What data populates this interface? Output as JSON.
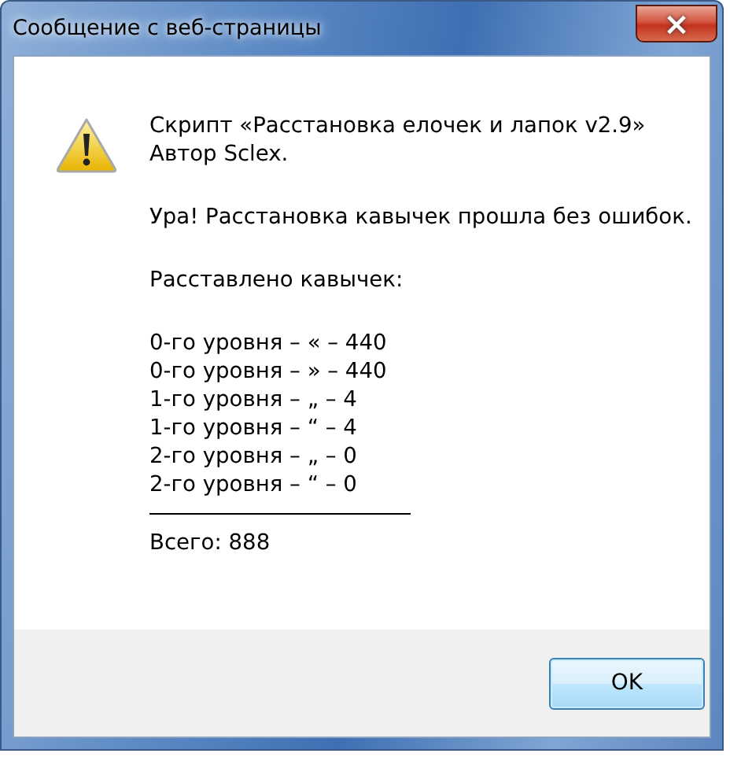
{
  "window": {
    "title": "Сообщение с веб-страницы",
    "close_button": "×"
  },
  "message": {
    "paragraphs": [
      {
        "lines": [
          "Скрипт «Расстановка елочек и лапок v2.9»",
          "Автор Sclex."
        ]
      },
      {
        "lines": [
          "Ура! Расстановка кавычек прошла без ошибок."
        ]
      },
      {
        "lines": [
          "Расставлено кавычек:"
        ]
      },
      {
        "lines": [
          "0-го уровня – « – 440",
          "0-го уровня – » – 440",
          "1-го уровня – „ – 4",
          "1-го уровня – “ – 4",
          "2-го уровня – „ – 0",
          "2-го уровня – “ – 0"
        ]
      }
    ],
    "total": "Всего: 888"
  },
  "buttons": [
    "OK"
  ]
}
